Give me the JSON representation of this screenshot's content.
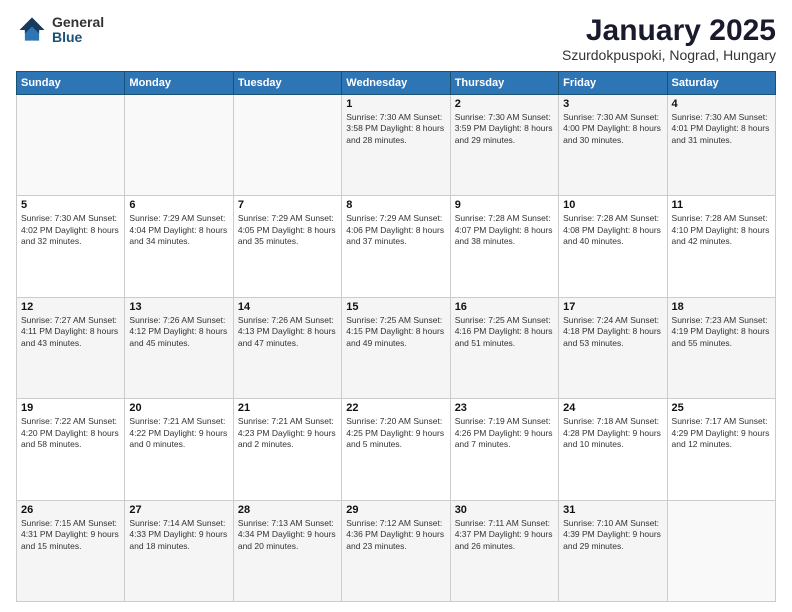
{
  "header": {
    "logo_general": "General",
    "logo_blue": "Blue",
    "title": "January 2025",
    "subtitle": "Szurdokpuspoki, Nograd, Hungary"
  },
  "days_of_week": [
    "Sunday",
    "Monday",
    "Tuesday",
    "Wednesday",
    "Thursday",
    "Friday",
    "Saturday"
  ],
  "weeks": [
    [
      {
        "day": "",
        "content": ""
      },
      {
        "day": "",
        "content": ""
      },
      {
        "day": "",
        "content": ""
      },
      {
        "day": "1",
        "content": "Sunrise: 7:30 AM\nSunset: 3:58 PM\nDaylight: 8 hours\nand 28 minutes."
      },
      {
        "day": "2",
        "content": "Sunrise: 7:30 AM\nSunset: 3:59 PM\nDaylight: 8 hours\nand 29 minutes."
      },
      {
        "day": "3",
        "content": "Sunrise: 7:30 AM\nSunset: 4:00 PM\nDaylight: 8 hours\nand 30 minutes."
      },
      {
        "day": "4",
        "content": "Sunrise: 7:30 AM\nSunset: 4:01 PM\nDaylight: 8 hours\nand 31 minutes."
      }
    ],
    [
      {
        "day": "5",
        "content": "Sunrise: 7:30 AM\nSunset: 4:02 PM\nDaylight: 8 hours\nand 32 minutes."
      },
      {
        "day": "6",
        "content": "Sunrise: 7:29 AM\nSunset: 4:04 PM\nDaylight: 8 hours\nand 34 minutes."
      },
      {
        "day": "7",
        "content": "Sunrise: 7:29 AM\nSunset: 4:05 PM\nDaylight: 8 hours\nand 35 minutes."
      },
      {
        "day": "8",
        "content": "Sunrise: 7:29 AM\nSunset: 4:06 PM\nDaylight: 8 hours\nand 37 minutes."
      },
      {
        "day": "9",
        "content": "Sunrise: 7:28 AM\nSunset: 4:07 PM\nDaylight: 8 hours\nand 38 minutes."
      },
      {
        "day": "10",
        "content": "Sunrise: 7:28 AM\nSunset: 4:08 PM\nDaylight: 8 hours\nand 40 minutes."
      },
      {
        "day": "11",
        "content": "Sunrise: 7:28 AM\nSunset: 4:10 PM\nDaylight: 8 hours\nand 42 minutes."
      }
    ],
    [
      {
        "day": "12",
        "content": "Sunrise: 7:27 AM\nSunset: 4:11 PM\nDaylight: 8 hours\nand 43 minutes."
      },
      {
        "day": "13",
        "content": "Sunrise: 7:26 AM\nSunset: 4:12 PM\nDaylight: 8 hours\nand 45 minutes."
      },
      {
        "day": "14",
        "content": "Sunrise: 7:26 AM\nSunset: 4:13 PM\nDaylight: 8 hours\nand 47 minutes."
      },
      {
        "day": "15",
        "content": "Sunrise: 7:25 AM\nSunset: 4:15 PM\nDaylight: 8 hours\nand 49 minutes."
      },
      {
        "day": "16",
        "content": "Sunrise: 7:25 AM\nSunset: 4:16 PM\nDaylight: 8 hours\nand 51 minutes."
      },
      {
        "day": "17",
        "content": "Sunrise: 7:24 AM\nSunset: 4:18 PM\nDaylight: 8 hours\nand 53 minutes."
      },
      {
        "day": "18",
        "content": "Sunrise: 7:23 AM\nSunset: 4:19 PM\nDaylight: 8 hours\nand 55 minutes."
      }
    ],
    [
      {
        "day": "19",
        "content": "Sunrise: 7:22 AM\nSunset: 4:20 PM\nDaylight: 8 hours\nand 58 minutes."
      },
      {
        "day": "20",
        "content": "Sunrise: 7:21 AM\nSunset: 4:22 PM\nDaylight: 9 hours\nand 0 minutes."
      },
      {
        "day": "21",
        "content": "Sunrise: 7:21 AM\nSunset: 4:23 PM\nDaylight: 9 hours\nand 2 minutes."
      },
      {
        "day": "22",
        "content": "Sunrise: 7:20 AM\nSunset: 4:25 PM\nDaylight: 9 hours\nand 5 minutes."
      },
      {
        "day": "23",
        "content": "Sunrise: 7:19 AM\nSunset: 4:26 PM\nDaylight: 9 hours\nand 7 minutes."
      },
      {
        "day": "24",
        "content": "Sunrise: 7:18 AM\nSunset: 4:28 PM\nDaylight: 9 hours\nand 10 minutes."
      },
      {
        "day": "25",
        "content": "Sunrise: 7:17 AM\nSunset: 4:29 PM\nDaylight: 9 hours\nand 12 minutes."
      }
    ],
    [
      {
        "day": "26",
        "content": "Sunrise: 7:15 AM\nSunset: 4:31 PM\nDaylight: 9 hours\nand 15 minutes."
      },
      {
        "day": "27",
        "content": "Sunrise: 7:14 AM\nSunset: 4:33 PM\nDaylight: 9 hours\nand 18 minutes."
      },
      {
        "day": "28",
        "content": "Sunrise: 7:13 AM\nSunset: 4:34 PM\nDaylight: 9 hours\nand 20 minutes."
      },
      {
        "day": "29",
        "content": "Sunrise: 7:12 AM\nSunset: 4:36 PM\nDaylight: 9 hours\nand 23 minutes."
      },
      {
        "day": "30",
        "content": "Sunrise: 7:11 AM\nSunset: 4:37 PM\nDaylight: 9 hours\nand 26 minutes."
      },
      {
        "day": "31",
        "content": "Sunrise: 7:10 AM\nSunset: 4:39 PM\nDaylight: 9 hours\nand 29 minutes."
      },
      {
        "day": "",
        "content": ""
      }
    ]
  ]
}
